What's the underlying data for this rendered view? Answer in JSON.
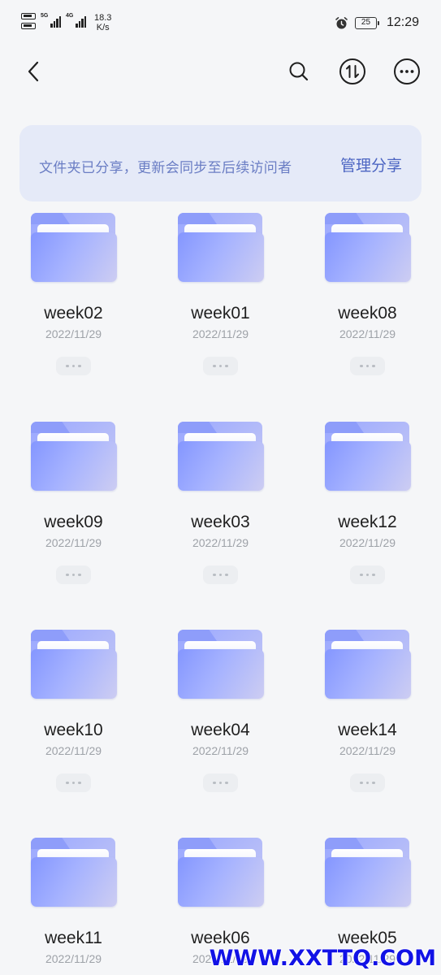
{
  "status_bar": {
    "sim1_network": "5G",
    "sim2_network": "4G",
    "net_speed_value": "18.3",
    "net_speed_unit": "K/s",
    "battery_level": "25",
    "time": "12:29",
    "icons": [
      "sim-card-icon",
      "signal-icon",
      "alarm-icon",
      "battery-icon"
    ]
  },
  "app_bar": {
    "icons": [
      "back-arrow-icon",
      "search-icon",
      "sort-icon",
      "more-icon"
    ]
  },
  "banner": {
    "message": "文件夹已分享，更新会同步至后续访问者",
    "action_label": "管理分享"
  },
  "folders": [
    {
      "name": "week02",
      "date": "2022/11/29"
    },
    {
      "name": "week01",
      "date": "2022/11/29"
    },
    {
      "name": "week08",
      "date": "2022/11/29"
    },
    {
      "name": "week09",
      "date": "2022/11/29"
    },
    {
      "name": "week03",
      "date": "2022/11/29"
    },
    {
      "name": "week12",
      "date": "2022/11/29"
    },
    {
      "name": "week10",
      "date": "2022/11/29"
    },
    {
      "name": "week04",
      "date": "2022/11/29"
    },
    {
      "name": "week14",
      "date": "2022/11/29"
    },
    {
      "name": "week11",
      "date": "2022/11/29"
    },
    {
      "name": "week06",
      "date": "2022/11/29"
    },
    {
      "name": "week05",
      "date": "2022/11/29"
    }
  ],
  "watermark": "WWW.XXTTQ.COM",
  "colors": {
    "accent": "#4c65c2",
    "banner_bg": "#e5eaf8",
    "folder_start": "#8496ff",
    "folder_end": "#cdcdf2",
    "watermark": "#1212e6"
  }
}
